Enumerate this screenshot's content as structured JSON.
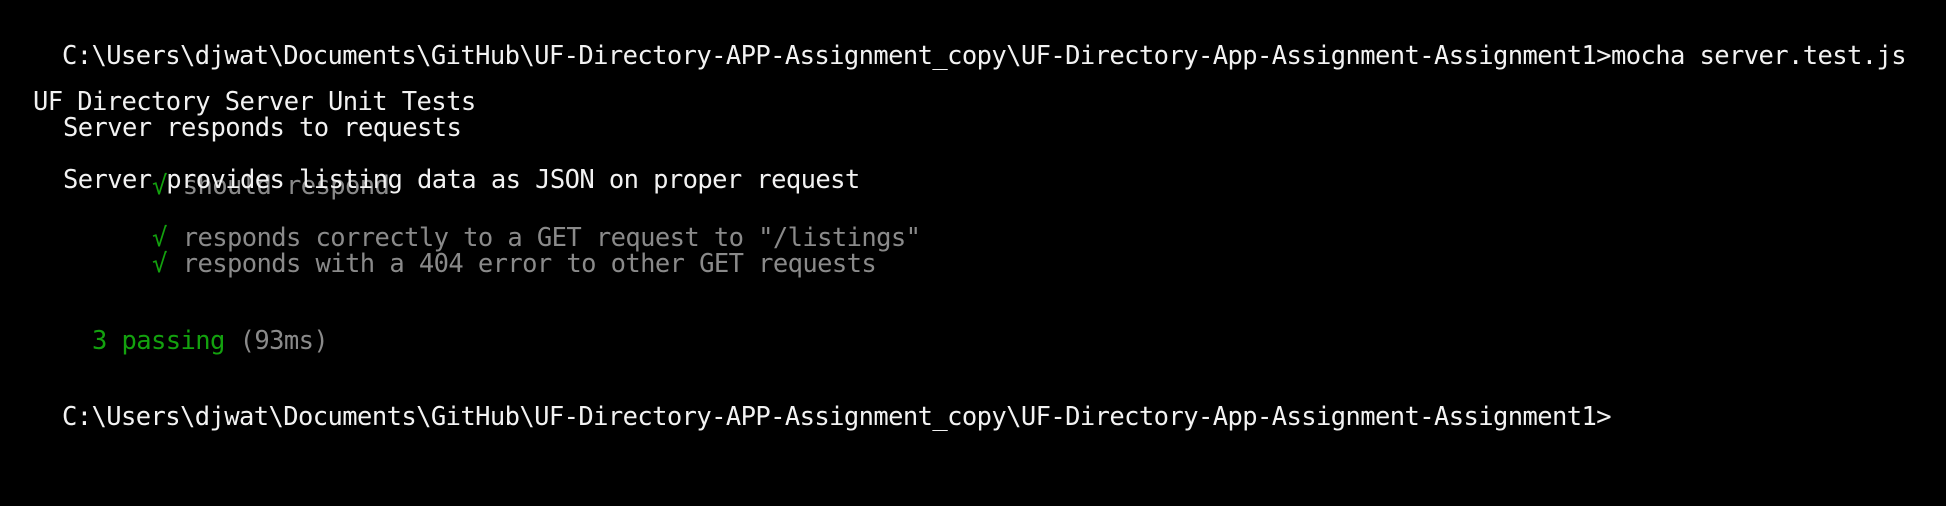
{
  "console": {
    "prompt_1": "C:\\Users\\djwat\\Documents\\GitHub\\UF-Directory-APP-Assignment_copy\\UF-Directory-App-Assignment-Assignment1>",
    "command_1": "mocha server.test.js",
    "suite_title": "UF Directory Server Unit Tests",
    "groups": [
      {
        "title": "Server responds to requests",
        "tests": [
          {
            "mark": "√",
            "text": "should respond"
          }
        ]
      },
      {
        "title": "Server provides listing data as JSON on proper request",
        "tests": [
          {
            "mark": "√",
            "text": "responds correctly to a GET request to \"/listings\""
          },
          {
            "mark": "√",
            "text": "responds with a 404 error to other GET requests"
          }
        ]
      }
    ],
    "summary": {
      "passing": "3 passing",
      "duration": "(93ms)"
    },
    "prompt_2": "C:\\Users\\djwat\\Documents\\GitHub\\UF-Directory-APP-Assignment_copy\\UF-Directory-App-Assignment-Assignment1>"
  },
  "colors": {
    "background": "#000000",
    "foreground": "#f2f2f2",
    "pass_green": "#13a10e",
    "dim_gray": "#8a8a8a"
  }
}
